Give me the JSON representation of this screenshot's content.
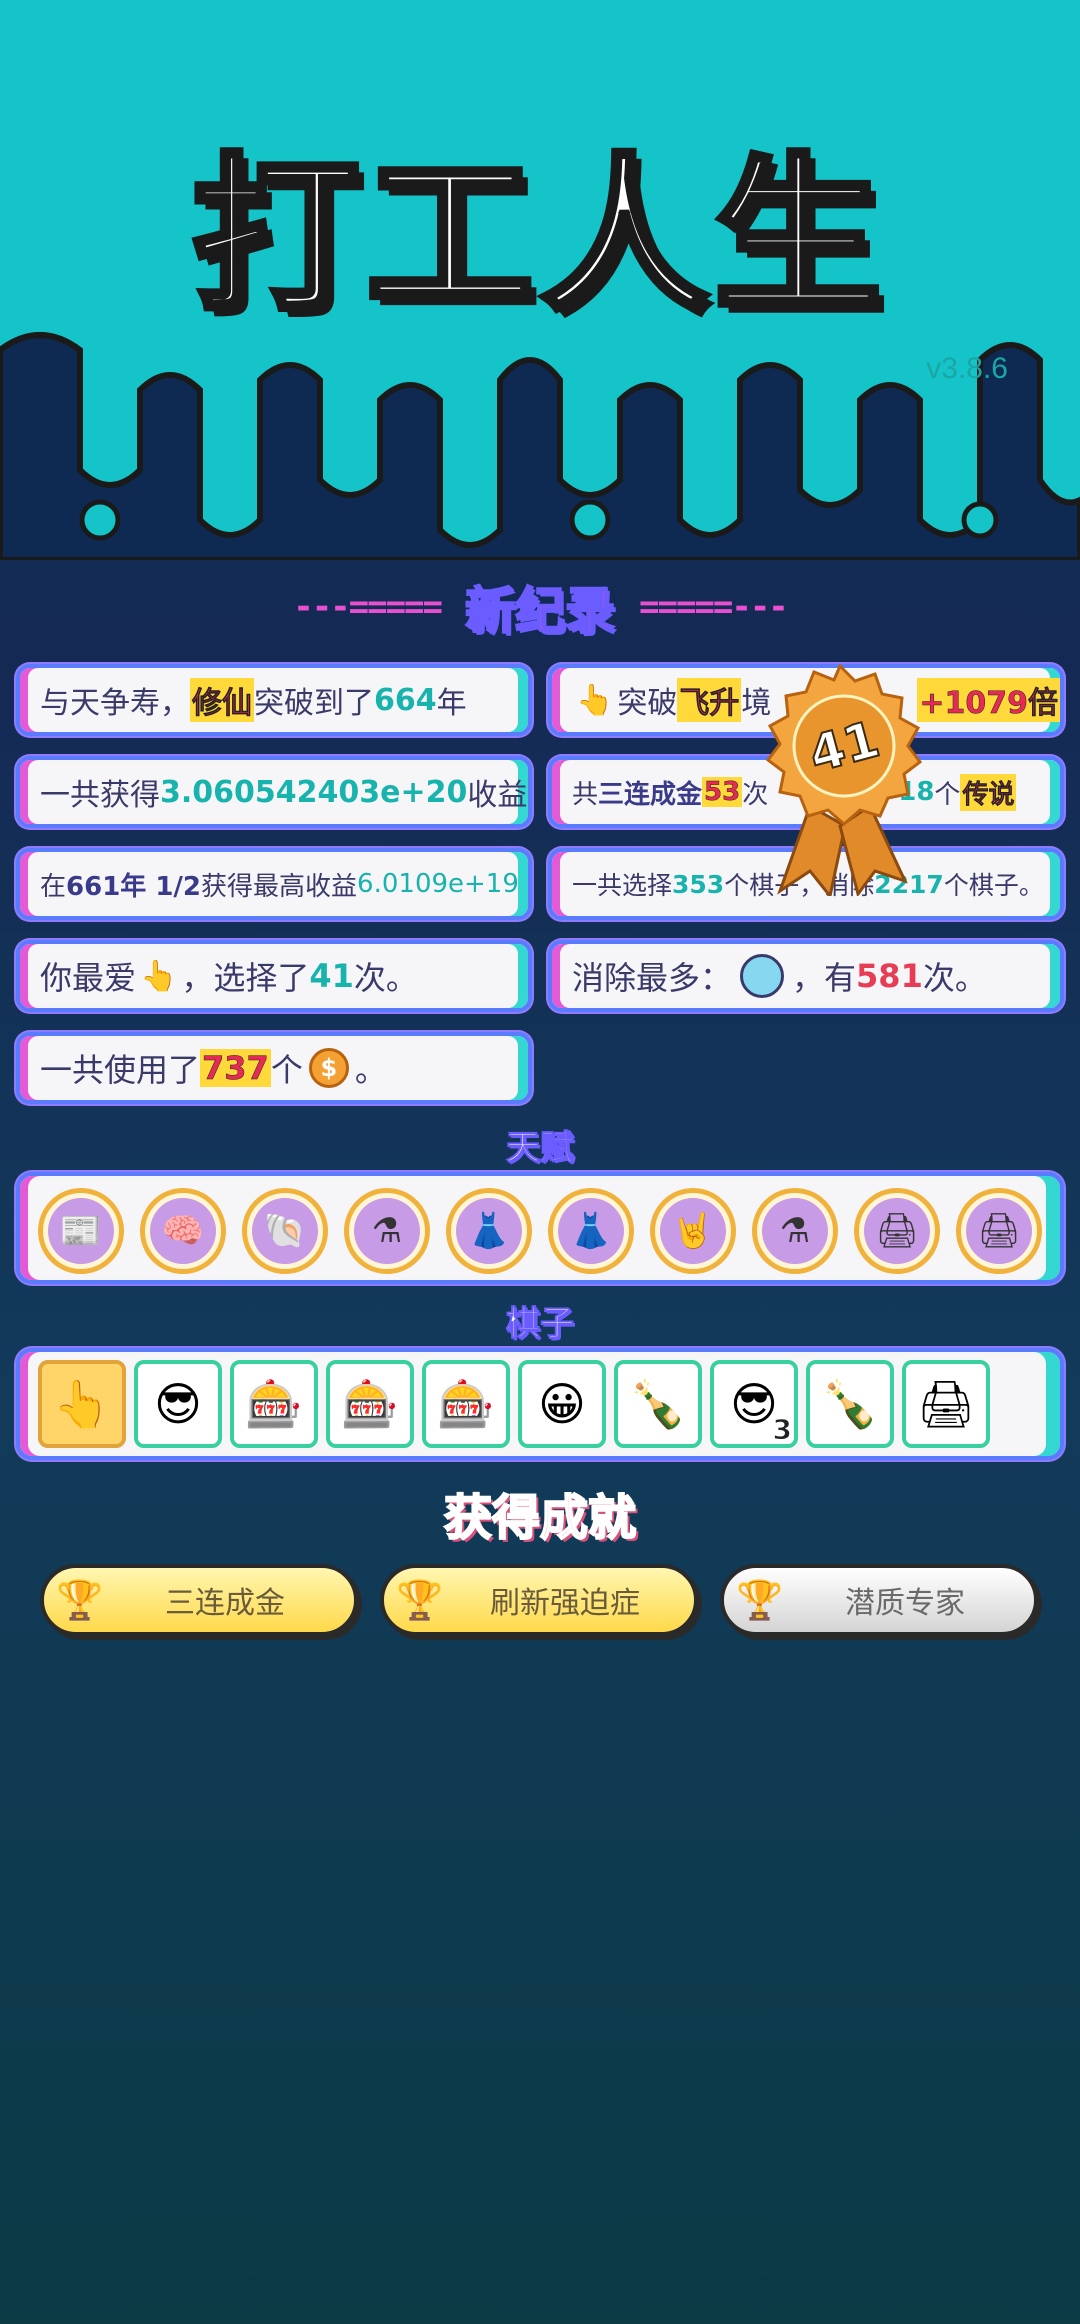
{
  "header": {
    "title": "打工人生",
    "version": "v3.8.6"
  },
  "record_banner": {
    "left_deco": "---=====",
    "text": "新纪录",
    "right_deco": "=====---"
  },
  "stats": {
    "longevity": {
      "prefix": "与天争寿，",
      "highlight": "修仙",
      "middle": "突破到了",
      "value": "664",
      "suffix": "年"
    },
    "breakthrough": {
      "icon": "👆",
      "prefix": "突破",
      "highlight": "飞升",
      "middle": "境",
      "value": "+1079倍"
    },
    "total_income": {
      "prefix": "一共获得",
      "value": "3.060542403e+20",
      "suffix": "收益"
    },
    "triple_gold": {
      "prefix": "共",
      "highlight": "三连成金",
      "value": "53",
      "middle": "次",
      "value2": "18",
      "suffix": "个",
      "tag": "传说"
    },
    "best_income": {
      "prefix": "在 ",
      "when": "661年 1/2",
      "middle": " 获得最高收益",
      "value": "6.0109e+19"
    },
    "selection": {
      "prefix": "一共选择",
      "selected": "353",
      "middle": "个棋子，",
      "mid2": "消除",
      "removed": "2217",
      "suffix": "个棋子。"
    },
    "favorite": {
      "prefix": "你最爱",
      "icon": "👆",
      "middle": "，选择了",
      "value": "41",
      "suffix": "次。"
    },
    "most_removed": {
      "prefix": "消除最多：",
      "middle": "，有",
      "value": "581",
      "suffix": "次。"
    },
    "coins_used": {
      "prefix": "一共使用了",
      "value": "737",
      "middle": "个",
      "coin_symbol": "$",
      "suffix": "。"
    }
  },
  "medal": {
    "value": "41"
  },
  "talents": {
    "label": "天赋",
    "icons": [
      "time-magazine-icon",
      "brain-icon",
      "shell-icon",
      "potion-icon",
      "skirt-icon",
      "skirt-icon",
      "rock-hand-icon",
      "potion-icon",
      "printer-warning-icon",
      "printer-warning-icon"
    ],
    "glyphs": [
      "📰",
      "🧠",
      "🐚",
      "⚗",
      "👗",
      "👗",
      "🤘",
      "⚗",
      "🖨",
      "🖨"
    ]
  },
  "pieces": {
    "label": "棋子",
    "items": [
      {
        "name": "hand-pointer-icon",
        "glyph": "👆",
        "selected": true,
        "count": ""
      },
      {
        "name": "green-cap-guy-icon",
        "glyph": "😎",
        "selected": false,
        "count": ""
      },
      {
        "name": "claw-machine-icon",
        "glyph": "🎰",
        "selected": false,
        "count": ""
      },
      {
        "name": "claw-machine-icon",
        "glyph": "🎰",
        "selected": false,
        "count": ""
      },
      {
        "name": "claw-machine-icon",
        "glyph": "🎰",
        "selected": false,
        "count": ""
      },
      {
        "name": "bald-guy-icon",
        "glyph": "😀",
        "selected": false,
        "count": ""
      },
      {
        "name": "green-bottle-icon",
        "glyph": "🍾",
        "selected": false,
        "count": ""
      },
      {
        "name": "green-cap-guy-icon",
        "glyph": "😎",
        "selected": false,
        "count": "3"
      },
      {
        "name": "green-bottle-icon",
        "glyph": "🍾",
        "selected": false,
        "count": ""
      },
      {
        "name": "printer-icon",
        "glyph": "🖨",
        "selected": false,
        "count": ""
      }
    ]
  },
  "achievements": {
    "title": "获得成就",
    "items": [
      {
        "label": "三连成金",
        "tier": "gold",
        "trophy": "🏆"
      },
      {
        "label": "刷新强迫症",
        "tier": "gold",
        "trophy": "🏆"
      },
      {
        "label": "潜质专家",
        "tier": "silver",
        "trophy": "🏆"
      }
    ]
  },
  "colors": {
    "accent_teal": "#18b3ac",
    "accent_pink": "#e45ad6",
    "accent_blue": "#5b7bff",
    "highlight_gold": "#ffd93a"
  }
}
